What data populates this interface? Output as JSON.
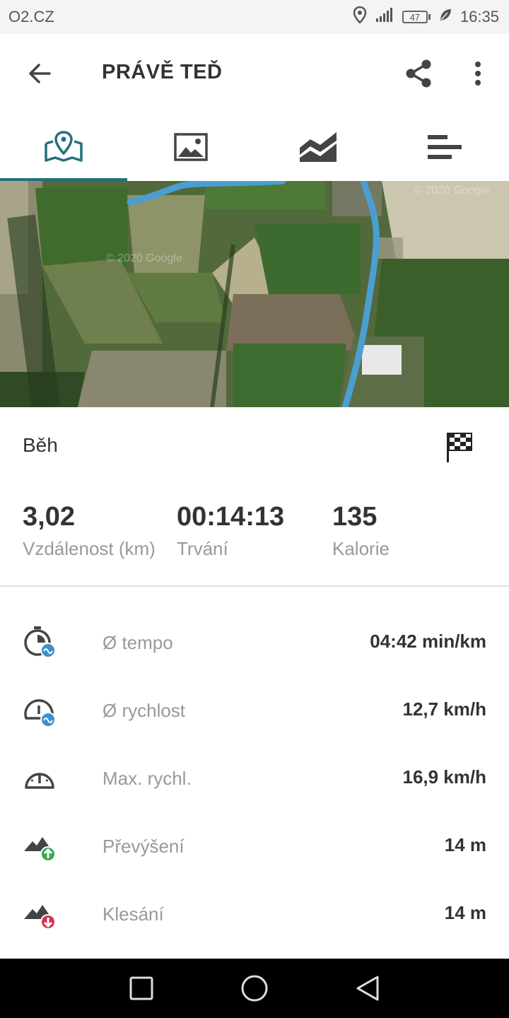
{
  "status_bar": {
    "carrier": "O2.CZ",
    "battery": "47",
    "time": "16:35",
    "icons": [
      "location-icon",
      "signal-icon",
      "battery-icon",
      "leaf-icon"
    ]
  },
  "header": {
    "title": "PRÁVĚ TEĎ",
    "icons": [
      "back-arrow-icon",
      "share-icon",
      "more-vert-icon"
    ]
  },
  "tabs": [
    {
      "icon": "map-pin-icon",
      "active": true
    },
    {
      "icon": "image-icon",
      "active": false
    },
    {
      "icon": "chart-icon",
      "active": false
    },
    {
      "icon": "bars-icon",
      "active": false
    }
  ],
  "map": {
    "watermarks": [
      "© 2020 Google",
      "© 2020 Google"
    ]
  },
  "activity": {
    "type": "Běh",
    "icon": "finish-flag-icon"
  },
  "stats": [
    {
      "value": "3,02",
      "label": "Vzdálenost (km)"
    },
    {
      "value": "00:14:13",
      "label": "Trvání"
    },
    {
      "value": "135",
      "label": "Kalorie"
    }
  ],
  "details": [
    {
      "icon": "stopwatch-avg-icon",
      "label": "Ø tempo",
      "value": "04:42 min/km"
    },
    {
      "icon": "speedometer-avg-icon",
      "label": "Ø rychlost",
      "value": "12,7 km/h"
    },
    {
      "icon": "speedometer-icon",
      "label": "Max. rychl.",
      "value": "16,9 km/h"
    },
    {
      "icon": "ascent-icon",
      "label": "Převýšení",
      "value": "14 m"
    },
    {
      "icon": "descent-icon",
      "label": "Klesání",
      "value": "14 m"
    }
  ],
  "colors": {
    "accent": "#23707a",
    "route": "#4a9fd0",
    "ascent_badge": "#3aa655",
    "descent_badge": "#d6334a"
  }
}
